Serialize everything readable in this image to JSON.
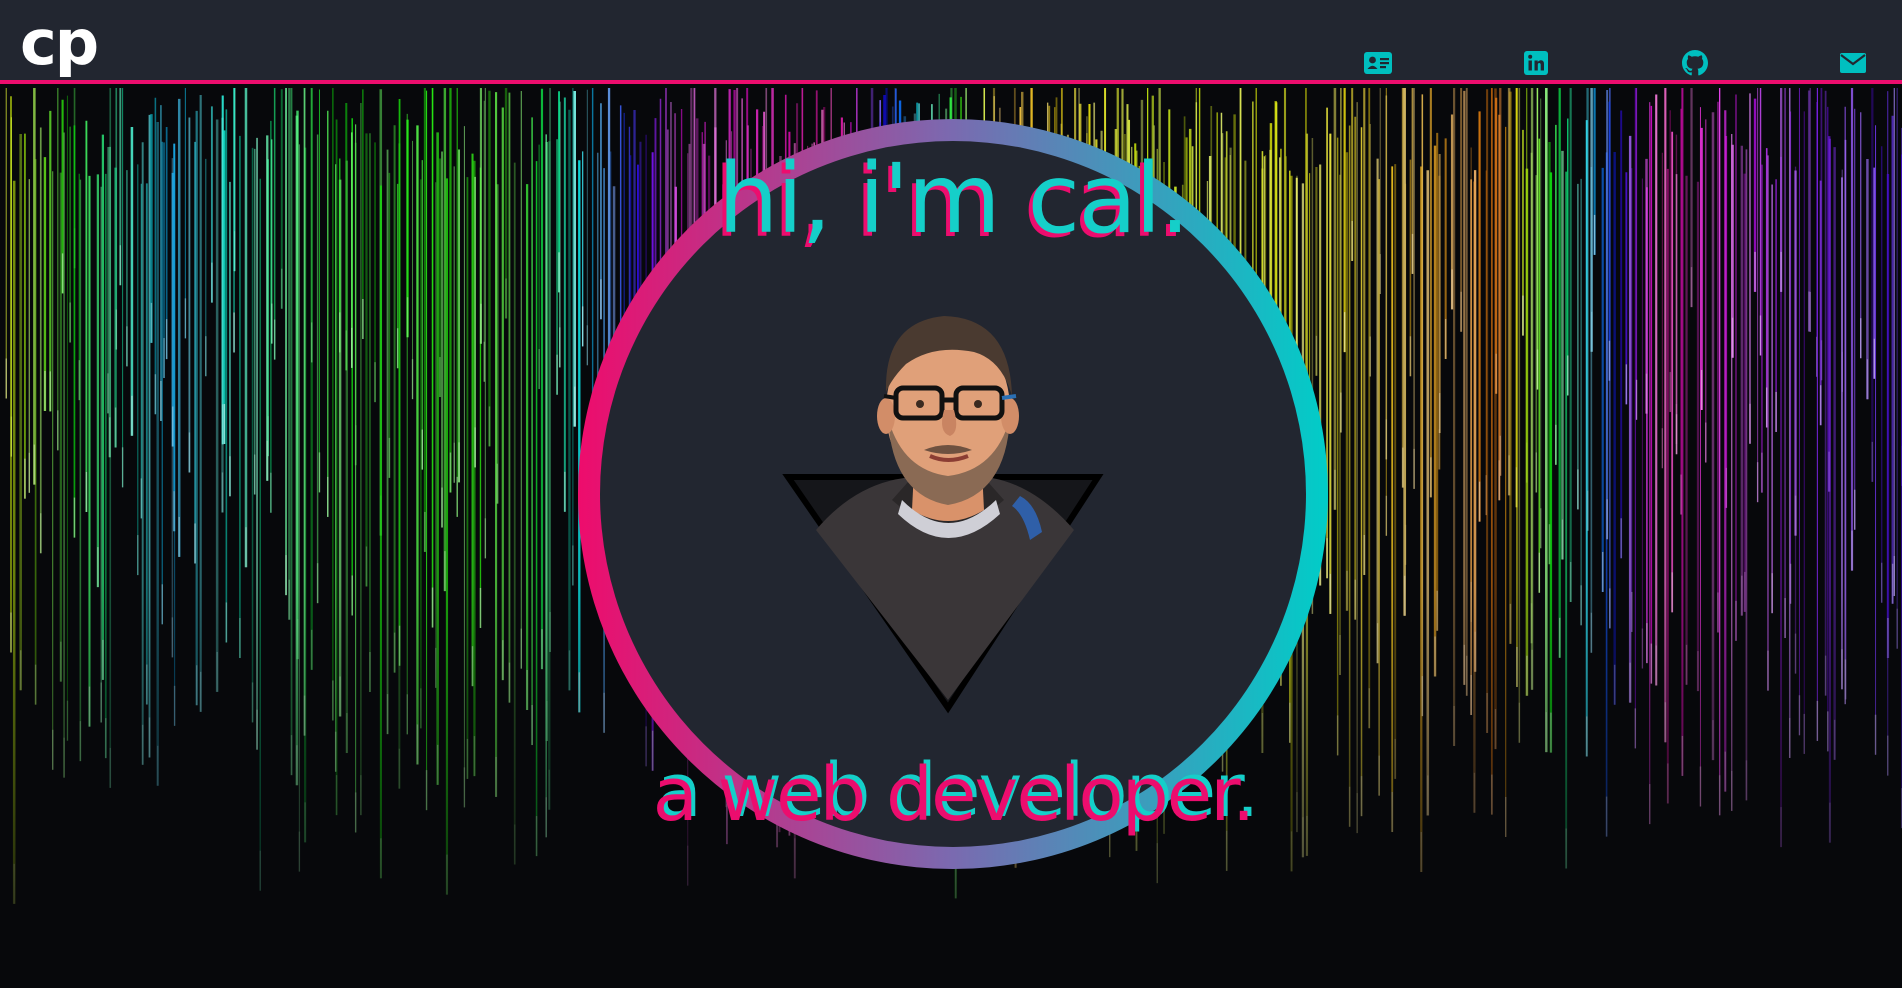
{
  "header": {
    "logo_text": "cp",
    "nav": [
      {
        "name": "resume",
        "icon": "id-card-icon"
      },
      {
        "name": "linkedin",
        "icon": "linkedin-icon"
      },
      {
        "name": "github",
        "icon": "github-icon"
      },
      {
        "name": "email",
        "icon": "envelope-icon"
      }
    ]
  },
  "hero": {
    "greeting": "hi, i'm cal.",
    "tagline": "a web developer."
  },
  "colors": {
    "nav_bg": "#222630",
    "accent_pink": "#ec0d6e",
    "accent_teal": "#15cfc9",
    "icon": "#00bfbf"
  }
}
